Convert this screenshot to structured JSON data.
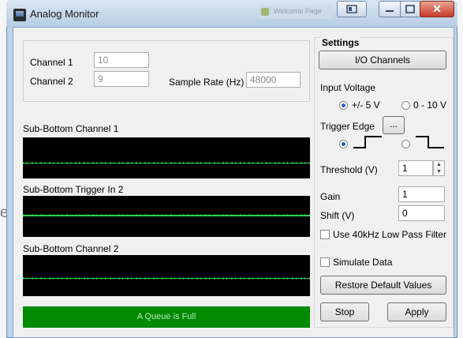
{
  "window": {
    "title": "Analog Monitor",
    "background_tab_label": "Welcome Page"
  },
  "desktop": {
    "partial_text": "e"
  },
  "channels": {
    "channel1_label": "Channel 1",
    "channel1_value": "10",
    "channel2_label": "Channel 2",
    "channel2_value": "9",
    "sample_rate_label": "Sample Rate (Hz)",
    "sample_rate_value": "48000"
  },
  "plots": [
    {
      "label": "Sub-Bottom Channel 1"
    },
    {
      "label": "Sub-Bottom Trigger In 2"
    },
    {
      "label": "Sub-Bottom Channel 2"
    }
  ],
  "status": {
    "text": "A Queue is Full",
    "color": "#008a00"
  },
  "settings": {
    "title": "Settings",
    "io_button": "I/O Channels",
    "input_voltage_label": "Input Voltage",
    "voltage_options": [
      "+/- 5 V",
      "0 - 10 V"
    ],
    "voltage_selected": "+/- 5 V",
    "trigger_edge_label": "Trigger Edge",
    "trigger_browse": "...",
    "trigger_selected": "rising",
    "threshold_label": "Threshold (V)",
    "threshold_value": "1",
    "gain_label": "Gain",
    "gain_value": "1",
    "shift_label": "Shift (V)",
    "shift_value": "0",
    "lowpass_label": "Use 40kHz Low Pass Filter",
    "lowpass_checked": false,
    "simulate_label": "Simulate Data",
    "simulate_checked": false,
    "restore_button": "Restore Default Values",
    "stop_button": "Stop",
    "apply_button": "Apply"
  },
  "colors": {
    "plot_background": "#000000",
    "signal": "#2bd24a",
    "accent_radio": "#1f5fc7"
  }
}
